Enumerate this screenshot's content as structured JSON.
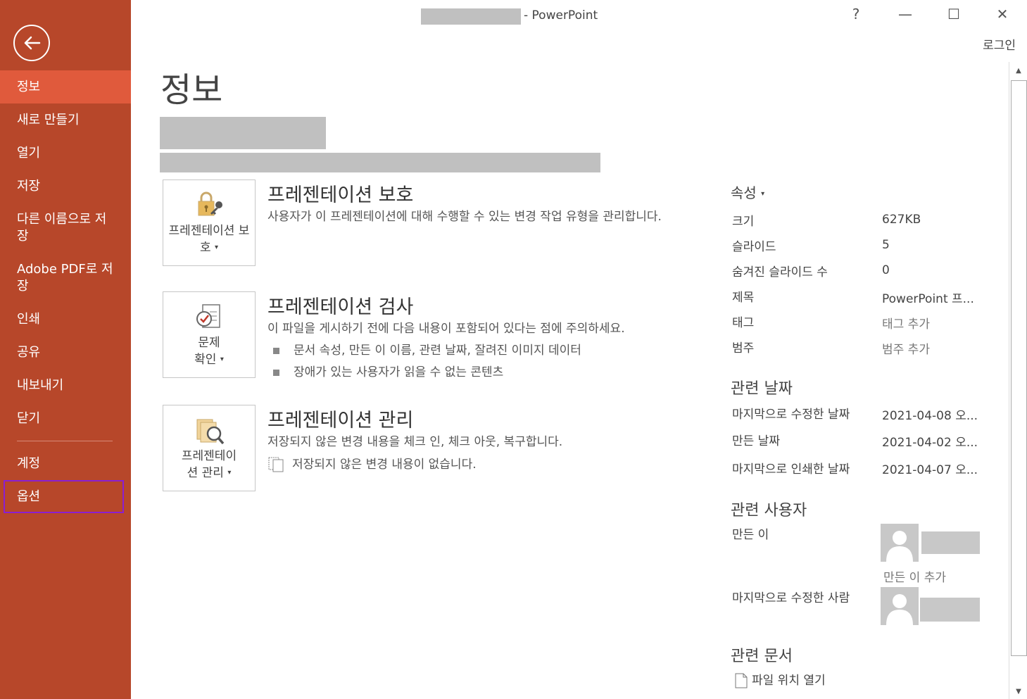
{
  "window": {
    "title": "- PowerPoint",
    "help": "?",
    "minimize": "—",
    "maximize": "☐",
    "close": "✕",
    "login": "로그인"
  },
  "sidebar": {
    "items": [
      {
        "label": "정보"
      },
      {
        "label": "새로 만들기"
      },
      {
        "label": "열기"
      },
      {
        "label": "저장"
      },
      {
        "label": "다른 이름으로 저장"
      },
      {
        "label": "Adobe PDF로 저장"
      },
      {
        "label": "인쇄"
      },
      {
        "label": "공유"
      },
      {
        "label": "내보내기"
      },
      {
        "label": "닫기"
      },
      {
        "label": "계정"
      },
      {
        "label": "옵션"
      }
    ]
  },
  "main": {
    "page_title": "정보",
    "protect": {
      "button": "프레젠테이션 보호",
      "title": "프레젠테이션 보호",
      "desc": "사용자가 이 프레젠테이션에 대해 수행할 수 있는 변경 작업 유형을 관리합니다."
    },
    "inspect": {
      "button_line1": "문제",
      "button_line2": "확인",
      "title": "프레젠테이션 검사",
      "desc": "이 파일을 게시하기 전에 다음 내용이 포함되어 있다는 점에 주의하세요.",
      "bullets": [
        "문서 속성, 만든 이 이름, 관련 날짜, 잘려진 이미지 데이터",
        "장애가 있는 사용자가 읽을 수 없는 콘텐츠"
      ]
    },
    "manage": {
      "button_line1": "프레젠테이",
      "button_line2": "션 관리",
      "title": "프레젠테이션 관리",
      "desc": "저장되지 않은 변경 내용을 체크 인, 체크 아웃, 복구합니다.",
      "note": "저장되지 않은 변경 내용이 없습니다."
    }
  },
  "properties": {
    "header": "속성",
    "rows": [
      {
        "label": "크기",
        "value": "627KB"
      },
      {
        "label": "슬라이드",
        "value": "5"
      },
      {
        "label": "숨겨진 슬라이드 수",
        "value": "0"
      },
      {
        "label": "제목",
        "value": "PowerPoint 프..."
      },
      {
        "label": "태그",
        "value": "태그 추가"
      },
      {
        "label": "범주",
        "value": "범주 추가"
      }
    ],
    "dates_title": "관련 날짜",
    "dates": [
      {
        "label": "마지막으로 수정한 날짜",
        "value": "2021-04-08 오..."
      },
      {
        "label": "만든 날짜",
        "value": "2021-04-02 오..."
      },
      {
        "label": "마지막으로 인쇄한 날짜",
        "value": "2021-04-07 오..."
      }
    ],
    "people_title": "관련 사용자",
    "author_label": "만든 이",
    "add_author": "만든 이 추가",
    "last_modified_by_label": "마지막으로 수정한 사람",
    "docs_title": "관련 문서",
    "open_location": "파일 위치 열기"
  }
}
